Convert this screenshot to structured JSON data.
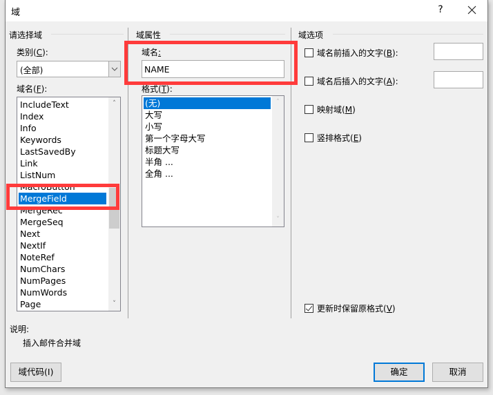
{
  "window": {
    "title": "域",
    "help_label": "?",
    "close_icon": "close-icon"
  },
  "left_panel": {
    "group_label": "请选择域",
    "category_label": "类别",
    "category_hotkey": "C",
    "category_value": "(全部)",
    "field_names_label": "域名",
    "field_names_hotkey": "F",
    "field_names": [
      "IncludeText",
      "Index",
      "Info",
      "Keywords",
      "LastSavedBy",
      "Link",
      "ListNum",
      "MacroButton",
      "MergeField",
      "MergeRec",
      "MergeSeq",
      "Next",
      "NextIf",
      "NoteRef",
      "NumChars",
      "NumPages",
      "NumWords",
      "Page"
    ],
    "selected_field": "MergeField"
  },
  "middle_panel": {
    "group_label": "域属性",
    "field_name_label": "域名",
    "field_name_value": "NAME",
    "format_label": "格式",
    "format_hotkey": "T",
    "formats": [
      "(无)",
      "大写",
      "小写",
      "第一个字母大写",
      "标题大写",
      "半角 ...",
      "全角 ..."
    ],
    "selected_format": "(无)"
  },
  "right_panel": {
    "group_label": "域选项",
    "options": [
      {
        "label": "域名前插入的文字",
        "hotkey": "B",
        "suffix": ":",
        "checked": false,
        "has_input": true,
        "input_value": ""
      },
      {
        "label": "域名后插入的文字",
        "hotkey": "A",
        "suffix": ":",
        "checked": false,
        "has_input": true,
        "input_value": ""
      },
      {
        "label": "映射域",
        "hotkey": "M",
        "suffix": "",
        "checked": false,
        "has_input": false
      },
      {
        "label": "竖排格式",
        "hotkey": "E",
        "suffix": "",
        "checked": false,
        "has_input": false
      }
    ],
    "preserve_format": {
      "label": "更新时保留原格式",
      "hotkey": "V",
      "checked": true
    }
  },
  "description": {
    "label": "说明:",
    "text": "插入邮件合并域"
  },
  "buttons": {
    "field_codes": "域代码(I)",
    "ok": "确定",
    "cancel": "取消"
  },
  "annotations": {
    "highlight_color": "#ff3b3b"
  }
}
